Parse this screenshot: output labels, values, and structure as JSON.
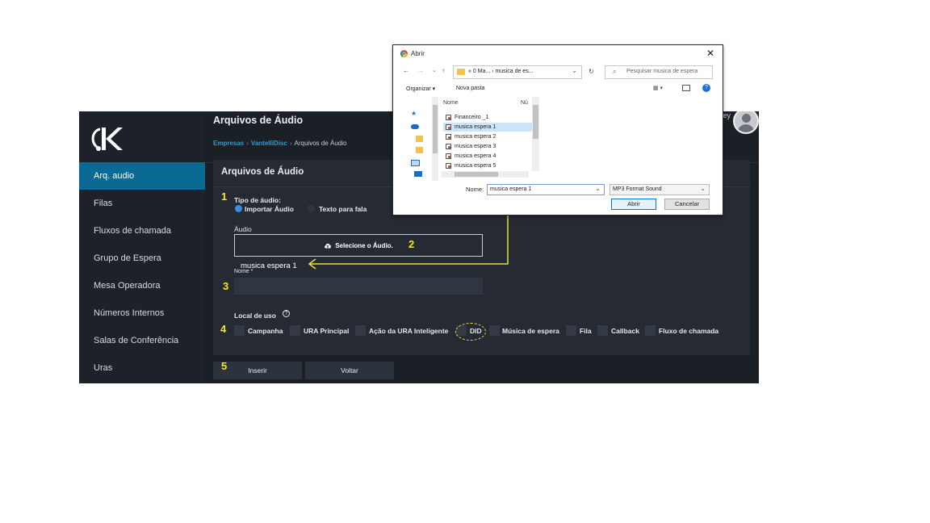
{
  "sidebar": {
    "items": [
      {
        "label": "Arq. audio",
        "active": true
      },
      {
        "label": "Filas"
      },
      {
        "label": "Fluxos de chamada"
      },
      {
        "label": "Grupo de Espera"
      },
      {
        "label": "Mesa Operadora"
      },
      {
        "label": "Números Internos"
      },
      {
        "label": "Salas de Conferência"
      },
      {
        "label": "Uras"
      }
    ]
  },
  "header": {
    "title": "Arquivos de Áudio",
    "breadcrumb": [
      "Empresas",
      "VantelliDisc",
      "Arquivos de Áudio"
    ],
    "user_name_fragment": "ey"
  },
  "panel": {
    "title": "Arquivos de Áudio",
    "audio_type_label": "Tipo de áudio:",
    "radio_import": "Importar Áudio",
    "radio_tts": "Texto para fala",
    "audio_label": "Áudio",
    "select_audio": "Selecione o Áudio.",
    "selected_file": "musica espera 1",
    "name_label": "Nome *",
    "name_value": "",
    "usage_label": "Local de uso",
    "usage_options": [
      "Campanha",
      "URA Principal",
      "Ação da URA Inteligente",
      "DID",
      "Música de espera",
      "Fila",
      "Callback",
      "Fluxo de chamada"
    ]
  },
  "buttons": {
    "insert": "Inserir",
    "back": "Voltar"
  },
  "steps": [
    "1",
    "2",
    "3",
    "4",
    "5"
  ],
  "dialog": {
    "title": "Abrir",
    "address": "« 0 Ma...  ›  musica de es...",
    "search_placeholder": "Pesquisar musica de espera",
    "organize": "Organizar ▾",
    "new_folder": "Nova pasta",
    "col_name": "Nome",
    "col_num": "Nú",
    "files": [
      "Financeiro _1",
      "musica espera 1",
      "musica espera 2",
      "musica espera 3",
      "musica espera 4",
      "musica espera 5"
    ],
    "selected_index": 1,
    "file_name_label": "Nome:",
    "file_name_value": "musica espera 1",
    "file_type": "MP3 Format Sound",
    "open_btn": "Abrir",
    "cancel_btn": "Cancelar"
  },
  "colors": {
    "accent": "#0b6a93",
    "link": "#2a9fd6",
    "annotation": "#f2ec1f",
    "radio_on": "#3a8ee0"
  }
}
